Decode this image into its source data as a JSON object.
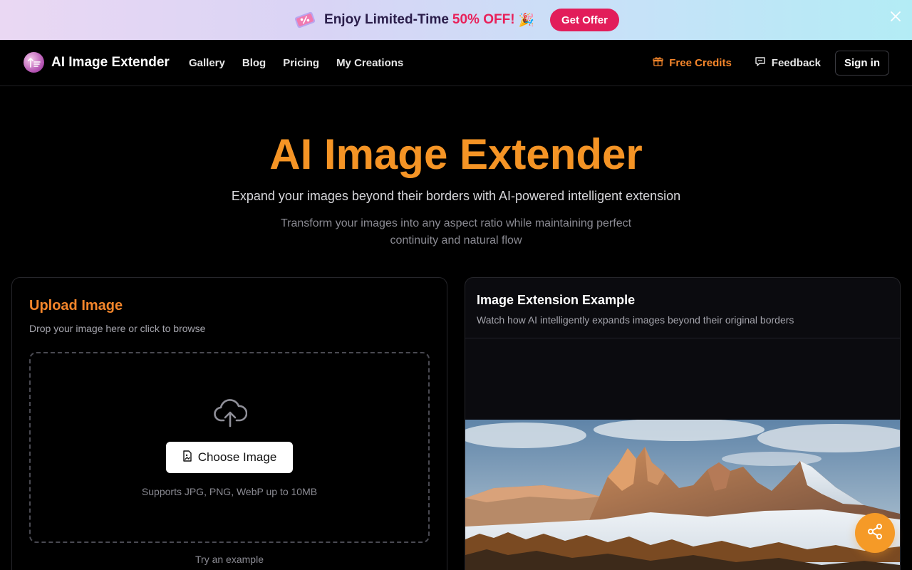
{
  "promo": {
    "text": "Enjoy Limited-Time",
    "highlight": "50% OFF!",
    "emoji": "🎉",
    "cta_label": "Get Offer",
    "accent_color": "#e21d5a"
  },
  "nav": {
    "logo_text": "AI Image Extender",
    "links": [
      "Gallery",
      "Blog",
      "Pricing",
      "My Creations"
    ],
    "free_credits_label": "Free Credits",
    "feedback_label": "Feedback",
    "signin_label": "Sign in",
    "accent_color": "#f5862b"
  },
  "hero": {
    "title": "AI Image Extender",
    "subtitle": "Expand your images beyond their borders with AI-powered intelligent extension",
    "description": "Transform your images into any aspect ratio while maintaining perfect continuity and natural flow",
    "title_color": "#f59425"
  },
  "upload": {
    "title": "Upload Image",
    "description": "Drop your image here or click to browse",
    "choose_label": "Choose Image",
    "supports_text": "Supports JPG, PNG, WebP up to 10MB",
    "try_example_label": "Try an example"
  },
  "example": {
    "title": "Image Extension Example",
    "description": "Watch how AI intelligently expands images beyond their original borders"
  },
  "icons": {
    "promo": "discount-ticket-icon",
    "close": "close-icon",
    "gift": "gift-icon",
    "feedback": "chat-bubble-icon",
    "upload": "cloud-upload-icon",
    "file": "image-file-icon",
    "share": "share-icon"
  }
}
